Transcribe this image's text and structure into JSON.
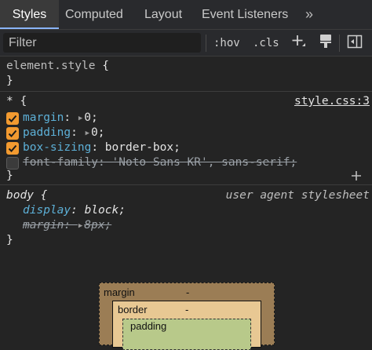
{
  "tabs": [
    {
      "label": "Styles"
    },
    {
      "label": "Computed"
    },
    {
      "label": "Layout"
    },
    {
      "label": "Event Listeners"
    },
    {
      "label": "»"
    }
  ],
  "filter": {
    "placeholder": "Filter",
    "hov_label": ":hov",
    "cls_label": ".cls"
  },
  "rules": {
    "element_style": {
      "selector": "element.style",
      "open": "{",
      "close": "}"
    },
    "universal": {
      "selector": "*",
      "open": "{",
      "close": "}",
      "source": "style.css:3",
      "declarations": [
        {
          "property": "margin",
          "value": "0",
          "checked": true,
          "expandable": true
        },
        {
          "property": "padding",
          "value": "0",
          "checked": true,
          "expandable": true
        },
        {
          "property": "box-sizing",
          "value": "border-box",
          "checked": true
        },
        {
          "property": "font-family",
          "value": "'Noto Sans KR', sans-serif",
          "checked": false,
          "overridden": true
        }
      ]
    },
    "body": {
      "selector": "body",
      "open": "{",
      "close": "}",
      "source": "user agent stylesheet",
      "declarations": [
        {
          "property": "display",
          "value": "block"
        },
        {
          "property": "margin",
          "value": "8px",
          "overridden": true
        }
      ]
    }
  },
  "box_model": {
    "margin": {
      "label": "margin",
      "value": "-"
    },
    "border": {
      "label": "border",
      "value": "-"
    },
    "padding": {
      "label": "padding"
    }
  },
  "colors": {
    "accent": "#f29a30",
    "property": "#5db0d7",
    "margin_box": "#9b7d55",
    "border_box": "#e8c893",
    "padding_box": "#b8c98a"
  }
}
